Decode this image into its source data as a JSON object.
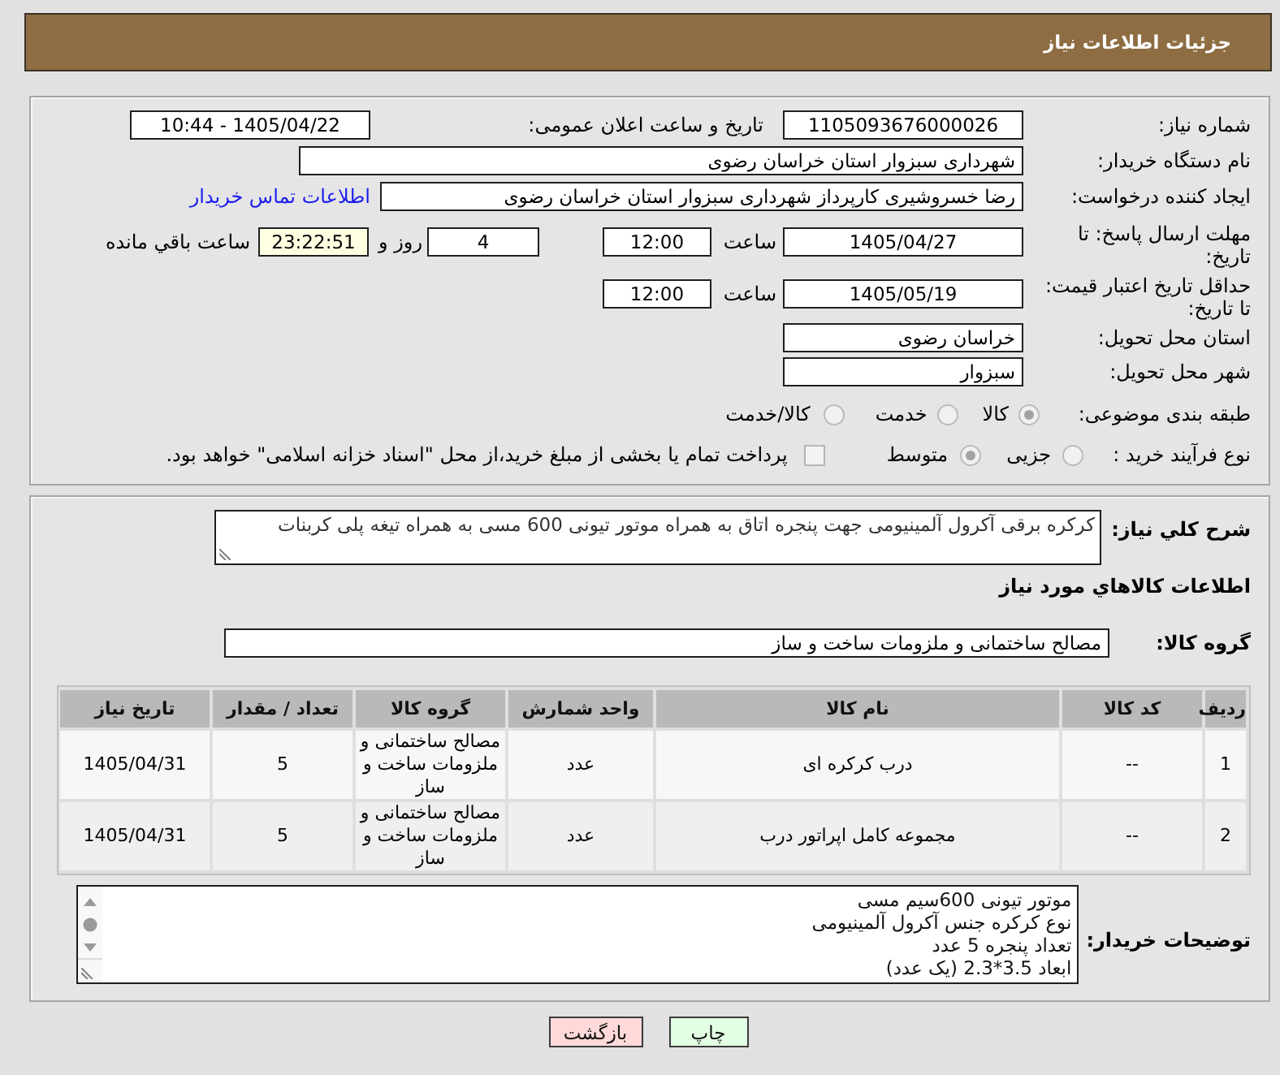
{
  "header": {
    "title": "جزئیات اطلاعات نیاز"
  },
  "summary": {
    "need_number": {
      "label": "شماره نیاز:",
      "value": "1105093676000026"
    },
    "announced": {
      "label": "تاریخ و ساعت اعلان عمومی:",
      "value": "1405/04/22 - 10:44"
    },
    "buyer": {
      "label": "نام دستگاه خریدار:",
      "value": "شهرداری سبزوار استان خراسان رضوی"
    },
    "requester": {
      "label": "ایجاد کننده درخواست:",
      "value": "رضا خسروشیری کارپرداز شهرداری سبزوار استان خراسان رضوی",
      "link": "اطلاعات تماس خریدار"
    },
    "reply_deadline": {
      "label": "مهلت ارسال پاسخ: تا تاریخ:",
      "date": "1405/04/27",
      "time_label": "ساعت",
      "time": "12:00",
      "days": "4",
      "days_label": "روز و",
      "remaining": "23:22:51",
      "remaining_label": "ساعت باقي مانده"
    },
    "price_validity": {
      "label": "حداقل تاریخ اعتبار قیمت: تا تاریخ:",
      "date": "1405/05/19",
      "time_label": "ساعت",
      "time": "12:00"
    },
    "province": {
      "label": "استان محل تحویل:",
      "value": "خراسان رضوی"
    },
    "city": {
      "label": "شهر محل تحویل:",
      "value": "سبزوار"
    },
    "category": {
      "label": "طبقه بندی موضوعی:",
      "options": [
        {
          "label": "کالا",
          "selected": true
        },
        {
          "label": "خدمت",
          "selected": false
        },
        {
          "label": "کالا/خدمت",
          "selected": false
        }
      ]
    },
    "process": {
      "label": "نوع فرآیند خرید :",
      "options": [
        {
          "label": "جزیی",
          "selected": false
        },
        {
          "label": "متوسط",
          "selected": true
        }
      ],
      "treasury": {
        "label": "پرداخت تمام یا بخشی از مبلغ خرید،از محل \"اسناد خزانه اسلامی\" خواهد بود.",
        "checked": false
      }
    }
  },
  "need": {
    "description_label": "شرح کلي نیاز:",
    "description": "کرکره برقی آکرول آلمینیومی جهت پنجره اتاق به همراه موتور تیونی 600 مسی به همراه تیغه پلی کربنات",
    "goods_title": "اطلاعات کالاهاي مورد نیاز",
    "group_label": "گروه کالا:",
    "group": "مصالح ساختمانی و ملزومات ساخت و ساز",
    "table": {
      "columns": [
        "ردیف",
        "کد کالا",
        "نام کالا",
        "واحد شمارش",
        "گروه کالا",
        "تعداد / مقدار",
        "تاریخ نیاز"
      ],
      "rows": [
        [
          "1",
          "--",
          "درب کرکره ای",
          "عدد",
          "مصالح ساختمانی و ملزومات ساخت و ساز",
          "5",
          "1405/04/31"
        ],
        [
          "2",
          "--",
          "مجموعه کامل اپراتور درب",
          "عدد",
          "مصالح ساختمانی و ملزومات ساخت و ساز",
          "5",
          "1405/04/31"
        ]
      ]
    },
    "notes_label": "توضیحات خریدار:",
    "notes": [
      "موتور تیونی 600سیم مسی",
      "نوع کرکره جنس آکرول آلمینیومی",
      "تعداد پنجره 5 عدد",
      "ابعاد 3.5*2.3 (یک عدد)"
    ]
  },
  "buttons": [
    {
      "label": "چاپ",
      "kind": "print"
    },
    {
      "label": "بازگشت",
      "kind": "back"
    }
  ]
}
